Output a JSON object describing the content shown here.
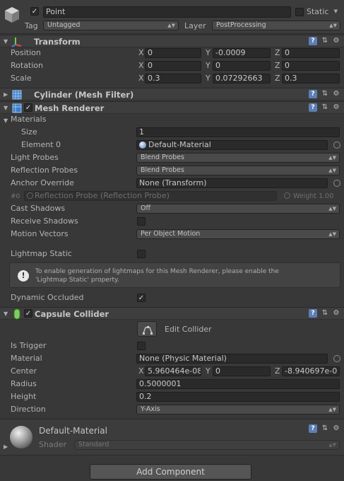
{
  "object": {
    "name": "Point",
    "static_label": "Static",
    "tag_label": "Tag",
    "tag_value": "Untagged",
    "layer_label": "Layer",
    "layer_value": "PostProcessing"
  },
  "transform": {
    "title": "Transform",
    "position_label": "Position",
    "rotation_label": "Rotation",
    "scale_label": "Scale",
    "axis_x": "X",
    "axis_y": "Y",
    "axis_z": "Z",
    "position": {
      "x": "0",
      "y": "-0.0009",
      "z": "0"
    },
    "rotation": {
      "x": "0",
      "y": "0",
      "z": "0"
    },
    "scale": {
      "x": "0.3",
      "y": "0.07292663",
      "z": "0.3"
    }
  },
  "mesh_filter": {
    "title": "Cylinder (Mesh Filter)"
  },
  "mesh_renderer": {
    "title": "Mesh Renderer",
    "materials_label": "Materials",
    "size_label": "Size",
    "size_value": "1",
    "element0_label": "Element 0",
    "element0_value": "Default-Material",
    "light_probes_label": "Light Probes",
    "light_probes_value": "Blend Probes",
    "reflection_probes_label": "Reflection Probes",
    "reflection_probes_value": "Blend Probes",
    "anchor_override_label": "Anchor Override",
    "anchor_override_value": "None (Transform)",
    "probe_index": "#0",
    "probe_name": "Reflection Probe (Reflection Probe)",
    "probe_weight": "Weight 1.00",
    "cast_shadows_label": "Cast Shadows",
    "cast_shadows_value": "Off",
    "receive_shadows_label": "Receive Shadows",
    "motion_vectors_label": "Motion Vectors",
    "motion_vectors_value": "Per Object Motion",
    "lightmap_static_label": "Lightmap Static",
    "help_line1": "To enable generation of lightmaps for this Mesh Renderer, please enable the",
    "help_line2": "'Lightmap Static' property.",
    "dynamic_occluded_label": "Dynamic Occluded"
  },
  "capsule_collider": {
    "title": "Capsule Collider",
    "edit_collider_label": "Edit Collider",
    "is_trigger_label": "Is Trigger",
    "material_label": "Material",
    "material_value": "None (Physic Material)",
    "center_label": "Center",
    "center": {
      "x": "5.960464e-08",
      "y": "0",
      "z": "-8.940697e-0"
    },
    "radius_label": "Radius",
    "radius_value": "0.5000001",
    "height_label": "Height",
    "height_value": "0.2",
    "direction_label": "Direction",
    "direction_value": "Y-Axis"
  },
  "material": {
    "name": "Default-Material",
    "shader_label": "Shader",
    "shader_value": "Standard"
  },
  "add_component_label": "Add Component",
  "colors": {
    "background": "#383838",
    "header": "#3e3e3e",
    "field": "#2a2a2a",
    "text": "#b4b4b4"
  }
}
